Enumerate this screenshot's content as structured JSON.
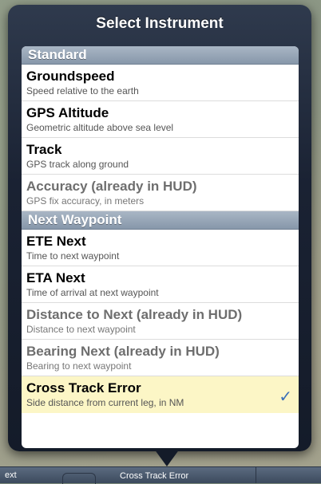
{
  "popover": {
    "title": "Select Instrument"
  },
  "sections": [
    {
      "header": "Standard",
      "items": [
        {
          "title": "Groundspeed",
          "subtitle": "Speed relative to the earth",
          "disabled": false,
          "selected": false
        },
        {
          "title": "GPS Altitude",
          "subtitle": "Geometric altitude above sea level",
          "disabled": false,
          "selected": false
        },
        {
          "title": "Track",
          "subtitle": "GPS track along ground",
          "disabled": false,
          "selected": false
        },
        {
          "title": "Accuracy (already in HUD)",
          "subtitle": "GPS fix accuracy, in meters",
          "disabled": true,
          "selected": false
        }
      ]
    },
    {
      "header": "Next Waypoint",
      "items": [
        {
          "title": "ETE Next",
          "subtitle": "Time to next waypoint",
          "disabled": false,
          "selected": false
        },
        {
          "title": "ETA Next",
          "subtitle": "Time of arrival at next waypoint",
          "disabled": false,
          "selected": false
        },
        {
          "title": "Distance to Next (already in HUD)",
          "subtitle": "Distance to next waypoint",
          "disabled": true,
          "selected": false
        },
        {
          "title": "Bearing Next (already in HUD)",
          "subtitle": "Bearing to next waypoint",
          "disabled": true,
          "selected": false
        },
        {
          "title": "Cross Track Error",
          "subtitle": "Side distance from current leg, in NM",
          "disabled": false,
          "selected": true
        }
      ]
    }
  ],
  "check_glyph": "✓",
  "toolbar": {
    "left_label": "ext",
    "center_label": "Cross Track Error"
  },
  "colors": {
    "selected_row": "#fcf6c6",
    "checkmark": "#3a6fb8",
    "section_header": "#8797aa"
  }
}
